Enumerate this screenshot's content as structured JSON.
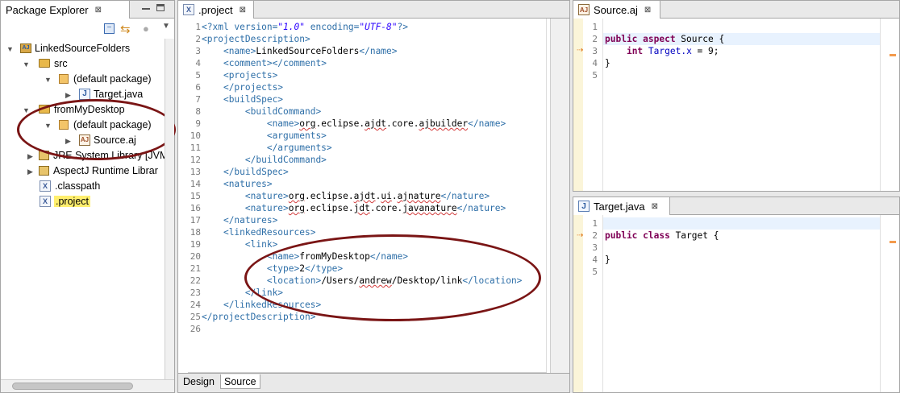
{
  "package_explorer": {
    "title": "Package Explorer",
    "close": "⊠",
    "toolbar": [
      "collapse-all-icon",
      "link-with-editor-icon",
      "focus-icon",
      "view-menu-icon"
    ],
    "tree": [
      {
        "label": "LinkedSourceFolders",
        "icon": "project-icon",
        "expanded": true
      },
      {
        "label": "src",
        "icon": "source-folder-icon",
        "expanded": true
      },
      {
        "label": "(default package)",
        "icon": "package-icon",
        "expanded": true
      },
      {
        "label": "Target.java",
        "icon": "java-file-icon",
        "expanded": false
      },
      {
        "label": "fromMyDesktop",
        "icon": "linked-folder-icon",
        "expanded": true
      },
      {
        "label": "(default package)",
        "icon": "package-icon",
        "expanded": true
      },
      {
        "label": "Source.aj",
        "icon": "aspectj-file-icon",
        "expanded": false
      },
      {
        "label": "JRE System Library [JVM",
        "icon": "library-icon",
        "expanded": false
      },
      {
        "label": "AspectJ Runtime Librar",
        "icon": "library-icon",
        "expanded": false
      },
      {
        "label": ".classpath",
        "icon": "xml-file-icon"
      },
      {
        "label": ".project",
        "icon": "xml-file-icon",
        "selected": true
      }
    ]
  },
  "project_editor": {
    "tab_label": ".project",
    "close": "⊠",
    "bottom_tabs": [
      "Design",
      "Source"
    ],
    "active_bottom_tab": "Source",
    "line_numbers": [
      "1",
      "2",
      "3",
      "4",
      "5",
      "6",
      "7",
      "8",
      "9",
      "10",
      "11",
      "12",
      "13",
      "14",
      "15",
      "16",
      "17",
      "18",
      "19",
      "20",
      "21",
      "22",
      "23",
      "24",
      "25",
      "26"
    ]
  },
  "source_editor": {
    "tab_label": "Source.aj",
    "close": "⊠",
    "line_numbers": [
      "1",
      "2",
      "3",
      "4",
      "5"
    ]
  },
  "target_editor": {
    "tab_label": "Target.java",
    "close": "⊠",
    "line_numbers": [
      "1",
      "2",
      "3",
      "4",
      "5"
    ]
  },
  "colors": {
    "annotation_ellipse": "#7a1515",
    "selection": "#ffef6e",
    "xml_tag": "#2e6fa8",
    "keyword": "#7f0055"
  }
}
